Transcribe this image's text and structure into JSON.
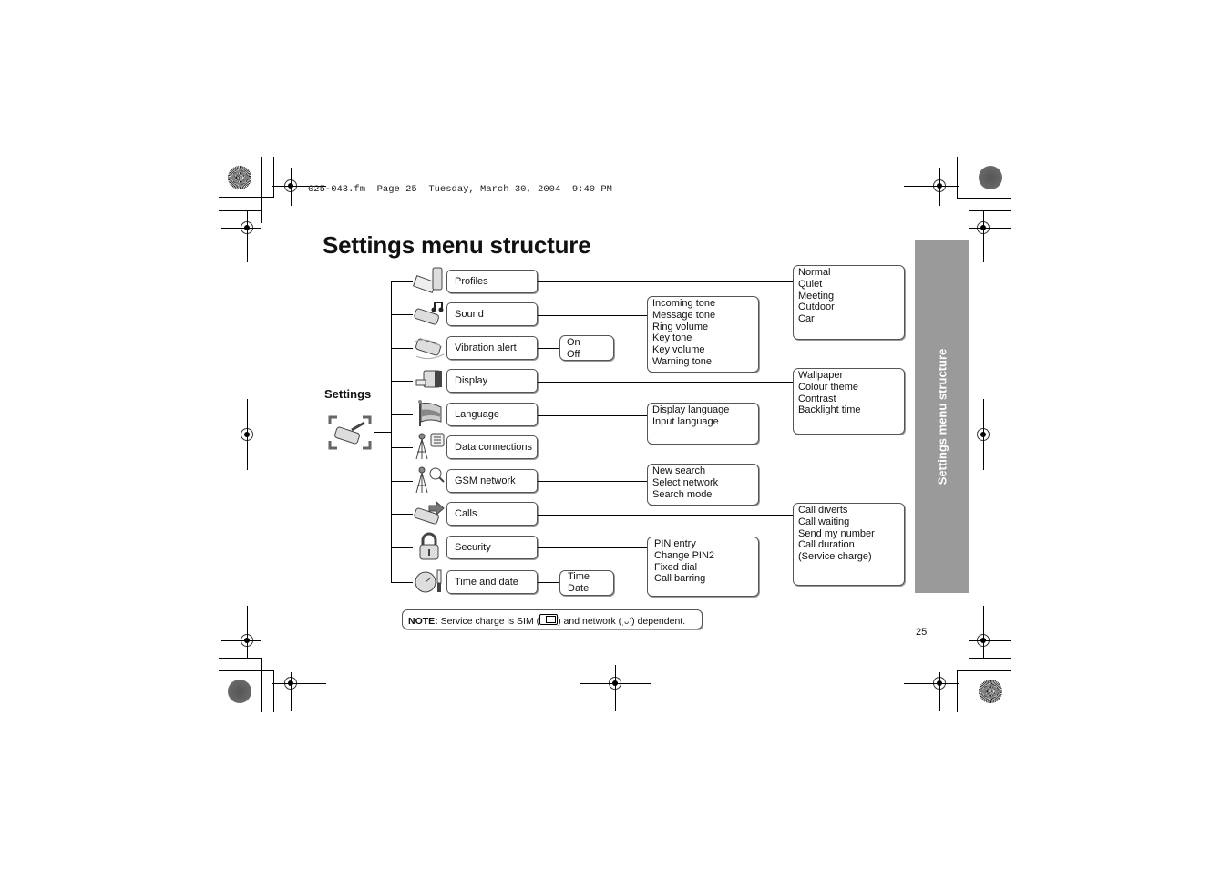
{
  "header": {
    "file_line": "025-043.fm  Page 25  Tuesday, March 30, 2004  9:40 PM"
  },
  "page": {
    "title": "Settings menu structure",
    "root_label": "Settings",
    "sidebar_label": "Settings menu structure",
    "page_number": "25"
  },
  "menu": [
    {
      "label": "Profiles",
      "icon": "profiles-icon"
    },
    {
      "label": "Sound",
      "icon": "sound-icon"
    },
    {
      "label": "Vibration alert",
      "icon": "vibration-icon"
    },
    {
      "label": "Display",
      "icon": "display-icon"
    },
    {
      "label": "Language",
      "icon": "language-flag-icon"
    },
    {
      "label": "Data connections",
      "icon": "data-connections-icon"
    },
    {
      "label": "GSM network",
      "icon": "gsm-network-icon"
    },
    {
      "label": "Calls",
      "icon": "calls-icon"
    },
    {
      "label": "Security",
      "icon": "padlock-icon"
    },
    {
      "label": "Time and date",
      "icon": "clock-icon"
    }
  ],
  "submenus": {
    "profiles": [
      "Normal",
      "Quiet",
      "Meeting",
      "Outdoor",
      "Car"
    ],
    "sound": [
      "Incoming tone",
      "Message tone",
      "Ring volume",
      "Key tone",
      "Key volume",
      "Warning tone"
    ],
    "vibration": [
      "On",
      "Off"
    ],
    "display": [
      "Wallpaper",
      "Colour theme",
      "Contrast",
      "Backlight time"
    ],
    "language": [
      "Display language",
      "Input language"
    ],
    "gsm": [
      "New search",
      "Select network",
      "Search mode"
    ],
    "calls": [
      "Call diverts",
      "Call waiting",
      "Send my number",
      "Call duration",
      "(Service charge)"
    ],
    "security": [
      "PIN entry",
      "Change PIN2",
      "Fixed dial",
      "Call barring"
    ],
    "time": [
      "Time",
      "Date"
    ]
  },
  "note": {
    "prefix": "NOTE:",
    "text_1": " Service charge is SIM (",
    "text_2": ") and network (",
    "text_3": ") dependent.",
    "sim_icon": "sim-card-icon",
    "network_icon": "network-antenna-icon"
  }
}
